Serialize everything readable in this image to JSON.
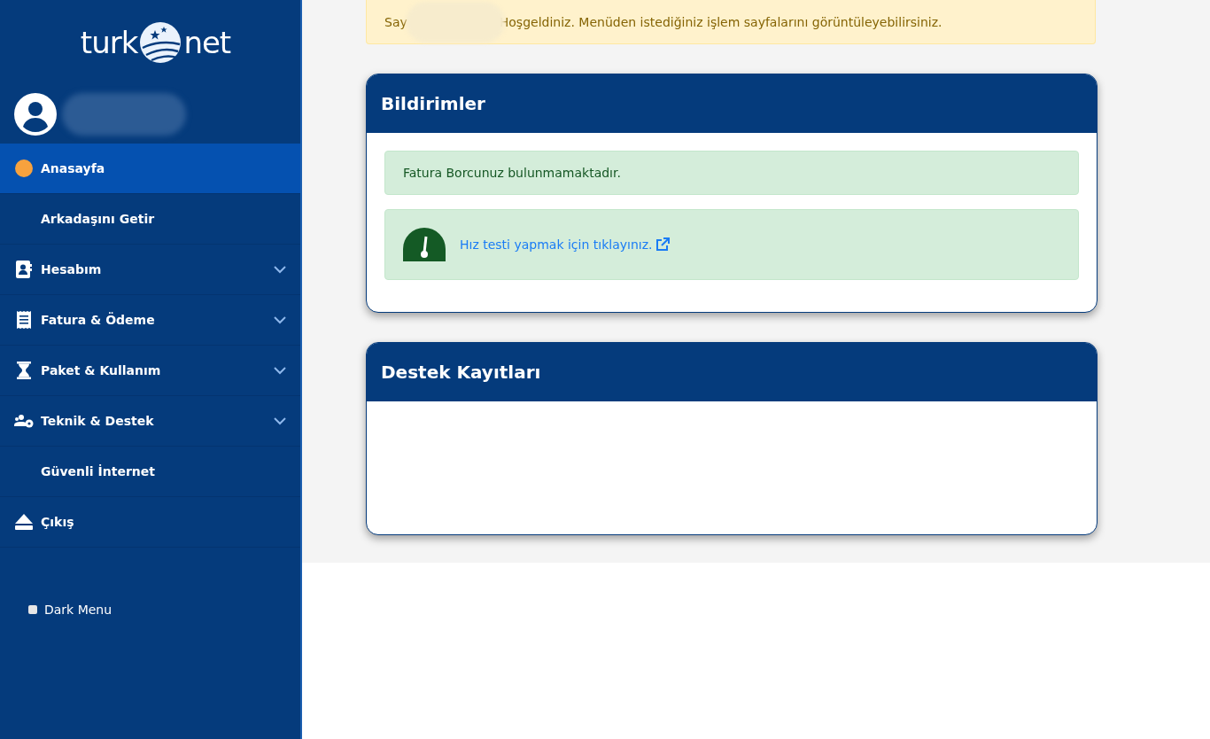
{
  "logo": {
    "left": "turk",
    "right": "net"
  },
  "menu": [
    {
      "label": "Anasayfa",
      "selected": true,
      "has_submenu": false
    },
    {
      "label": "Arkadaşını Getir",
      "selected": false,
      "has_submenu": false
    },
    {
      "label": "Hesabım",
      "selected": false,
      "has_submenu": true
    },
    {
      "label": "Fatura & Ödeme",
      "selected": false,
      "has_submenu": true
    },
    {
      "label": "Paket & Kullanım",
      "selected": false,
      "has_submenu": true
    },
    {
      "label": "Teknik & Destek",
      "selected": false,
      "has_submenu": true
    },
    {
      "label": "Güvenli İnternet",
      "selected": false,
      "has_submenu": false
    },
    {
      "label": "Çıkış",
      "selected": false,
      "has_submenu": false
    }
  ],
  "dark_menu": {
    "label": "Dark Menu",
    "checked": false
  },
  "welcome": {
    "before": "Say",
    "after": "Hoşgeldiniz. Menüden istediğiniz işlem sayfalarını görüntüleyebilirsiniz."
  },
  "cards": [
    {
      "title": "Bildirimler",
      "alerts": [
        {
          "kind": "text",
          "text": "Fatura Borcunuz bulunmamaktadır."
        },
        {
          "kind": "link",
          "text": "Hız testi yapmak için tıklayınız."
        }
      ]
    },
    {
      "title": "Destek Kayıtları"
    }
  ]
}
